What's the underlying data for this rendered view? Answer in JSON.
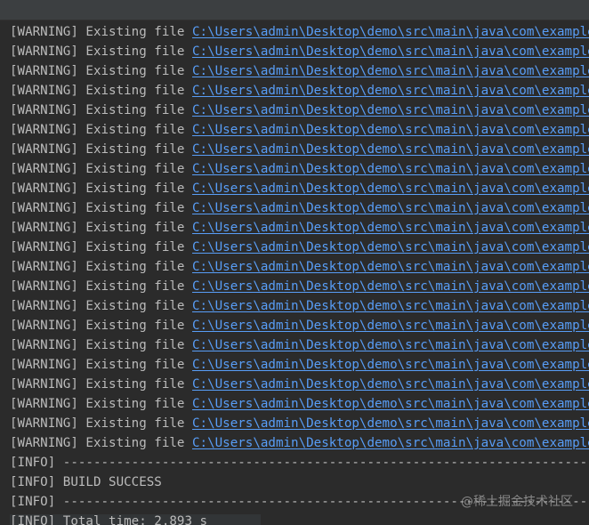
{
  "console": {
    "warning_tag": "[WARNING]",
    "existing_file_text": "Existing file",
    "file_path": "C:\\Users\\admin\\Desktop\\demo\\src\\main\\java\\com\\example\\demo",
    "warning_count": 22,
    "info_tag": "[INFO]",
    "separator": "------------------------------------------------------------------------",
    "build_success": "BUILD SUCCESS",
    "total_time": "Total time:  2.893 s"
  },
  "watermark": "@稀土掘金技术社区"
}
